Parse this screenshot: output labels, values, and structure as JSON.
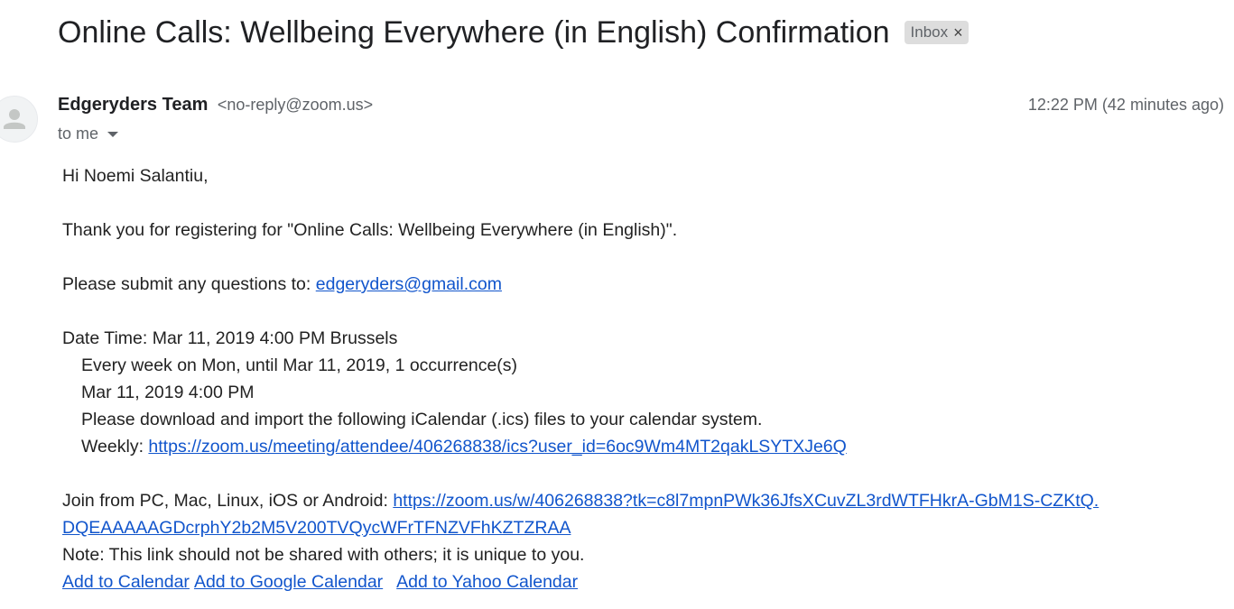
{
  "subject": {
    "title": "Online Calls: Wellbeing Everywhere (in English) Confirmation",
    "label": "Inbox",
    "label_close": "×"
  },
  "message": {
    "avatar_icon": "person-icon",
    "sender_name": "Edgeryders Team",
    "sender_email": "<no-reply@zoom.us>",
    "timestamp": "12:22 PM (42 minutes ago)",
    "recipient": "to me",
    "recipient_icon": "caret-down-icon"
  },
  "body": {
    "greeting": "Hi Noemi Salantiu,",
    "thanks": "Thank you for registering for \"Online Calls: Wellbeing Everywhere (in English)\".",
    "questions_prefix": "Please submit any questions to: ",
    "questions_email": "edgeryders@gmail.com",
    "datetime": "Date Time: Mar 11, 2019 4:00 PM Brussels",
    "recurrence": "Every week on Mon, until Mar 11, 2019, 1 occurrence(s)",
    "occurrence": "Mar 11, 2019 4:00 PM",
    "ics_note": "Please download and import the following iCalendar (.ics) files to your calendar system.",
    "weekly_prefix": "Weekly: ",
    "weekly_link": "https://zoom.us/meeting/attendee/406268838/ics?user_id=6oc9Wm4MT2qakLSYTXJe6Q",
    "join_prefix": "Join from PC, Mac, Linux, iOS or Android: ",
    "join_link_line1": "https://zoom.us/w/406268838?tk=c8l7mpnPWk36JfsXCuvZL3rdWTFHkrA-GbM1S-CZKtQ.",
    "join_link_line2": "DQEAAAAAGDcrphY2b2M5V200TVQycWFrTFNZVFhKZTZRAA",
    "note": "Note: This link should not be shared with others; it is unique to you.",
    "calendar_links": {
      "add_calendar": "Add to Calendar",
      "add_google": "Add to Google Calendar",
      "add_yahoo": "Add to Yahoo Calendar"
    }
  },
  "colors": {
    "link": "#1155cc",
    "text": "#222222",
    "muted": "#5f6368",
    "chip_bg": "#dddddd"
  }
}
